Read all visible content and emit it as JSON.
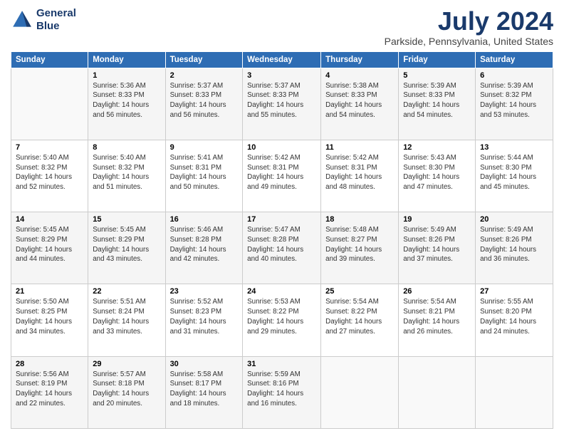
{
  "logo": {
    "line1": "General",
    "line2": "Blue"
  },
  "header": {
    "title": "July 2024",
    "subtitle": "Parkside, Pennsylvania, United States"
  },
  "columns": [
    "Sunday",
    "Monday",
    "Tuesday",
    "Wednesday",
    "Thursday",
    "Friday",
    "Saturday"
  ],
  "weeks": [
    [
      {
        "day": "",
        "sunrise": "",
        "sunset": "",
        "daylight": ""
      },
      {
        "day": "1",
        "sunrise": "Sunrise: 5:36 AM",
        "sunset": "Sunset: 8:33 PM",
        "daylight": "Daylight: 14 hours and 56 minutes."
      },
      {
        "day": "2",
        "sunrise": "Sunrise: 5:37 AM",
        "sunset": "Sunset: 8:33 PM",
        "daylight": "Daylight: 14 hours and 56 minutes."
      },
      {
        "day": "3",
        "sunrise": "Sunrise: 5:37 AM",
        "sunset": "Sunset: 8:33 PM",
        "daylight": "Daylight: 14 hours and 55 minutes."
      },
      {
        "day": "4",
        "sunrise": "Sunrise: 5:38 AM",
        "sunset": "Sunset: 8:33 PM",
        "daylight": "Daylight: 14 hours and 54 minutes."
      },
      {
        "day": "5",
        "sunrise": "Sunrise: 5:39 AM",
        "sunset": "Sunset: 8:33 PM",
        "daylight": "Daylight: 14 hours and 54 minutes."
      },
      {
        "day": "6",
        "sunrise": "Sunrise: 5:39 AM",
        "sunset": "Sunset: 8:32 PM",
        "daylight": "Daylight: 14 hours and 53 minutes."
      }
    ],
    [
      {
        "day": "7",
        "sunrise": "Sunrise: 5:40 AM",
        "sunset": "Sunset: 8:32 PM",
        "daylight": "Daylight: 14 hours and 52 minutes."
      },
      {
        "day": "8",
        "sunrise": "Sunrise: 5:40 AM",
        "sunset": "Sunset: 8:32 PM",
        "daylight": "Daylight: 14 hours and 51 minutes."
      },
      {
        "day": "9",
        "sunrise": "Sunrise: 5:41 AM",
        "sunset": "Sunset: 8:31 PM",
        "daylight": "Daylight: 14 hours and 50 minutes."
      },
      {
        "day": "10",
        "sunrise": "Sunrise: 5:42 AM",
        "sunset": "Sunset: 8:31 PM",
        "daylight": "Daylight: 14 hours and 49 minutes."
      },
      {
        "day": "11",
        "sunrise": "Sunrise: 5:42 AM",
        "sunset": "Sunset: 8:31 PM",
        "daylight": "Daylight: 14 hours and 48 minutes."
      },
      {
        "day": "12",
        "sunrise": "Sunrise: 5:43 AM",
        "sunset": "Sunset: 8:30 PM",
        "daylight": "Daylight: 14 hours and 47 minutes."
      },
      {
        "day": "13",
        "sunrise": "Sunrise: 5:44 AM",
        "sunset": "Sunset: 8:30 PM",
        "daylight": "Daylight: 14 hours and 45 minutes."
      }
    ],
    [
      {
        "day": "14",
        "sunrise": "Sunrise: 5:45 AM",
        "sunset": "Sunset: 8:29 PM",
        "daylight": "Daylight: 14 hours and 44 minutes."
      },
      {
        "day": "15",
        "sunrise": "Sunrise: 5:45 AM",
        "sunset": "Sunset: 8:29 PM",
        "daylight": "Daylight: 14 hours and 43 minutes."
      },
      {
        "day": "16",
        "sunrise": "Sunrise: 5:46 AM",
        "sunset": "Sunset: 8:28 PM",
        "daylight": "Daylight: 14 hours and 42 minutes."
      },
      {
        "day": "17",
        "sunrise": "Sunrise: 5:47 AM",
        "sunset": "Sunset: 8:28 PM",
        "daylight": "Daylight: 14 hours and 40 minutes."
      },
      {
        "day": "18",
        "sunrise": "Sunrise: 5:48 AM",
        "sunset": "Sunset: 8:27 PM",
        "daylight": "Daylight: 14 hours and 39 minutes."
      },
      {
        "day": "19",
        "sunrise": "Sunrise: 5:49 AM",
        "sunset": "Sunset: 8:26 PM",
        "daylight": "Daylight: 14 hours and 37 minutes."
      },
      {
        "day": "20",
        "sunrise": "Sunrise: 5:49 AM",
        "sunset": "Sunset: 8:26 PM",
        "daylight": "Daylight: 14 hours and 36 minutes."
      }
    ],
    [
      {
        "day": "21",
        "sunrise": "Sunrise: 5:50 AM",
        "sunset": "Sunset: 8:25 PM",
        "daylight": "Daylight: 14 hours and 34 minutes."
      },
      {
        "day": "22",
        "sunrise": "Sunrise: 5:51 AM",
        "sunset": "Sunset: 8:24 PM",
        "daylight": "Daylight: 14 hours and 33 minutes."
      },
      {
        "day": "23",
        "sunrise": "Sunrise: 5:52 AM",
        "sunset": "Sunset: 8:23 PM",
        "daylight": "Daylight: 14 hours and 31 minutes."
      },
      {
        "day": "24",
        "sunrise": "Sunrise: 5:53 AM",
        "sunset": "Sunset: 8:22 PM",
        "daylight": "Daylight: 14 hours and 29 minutes."
      },
      {
        "day": "25",
        "sunrise": "Sunrise: 5:54 AM",
        "sunset": "Sunset: 8:22 PM",
        "daylight": "Daylight: 14 hours and 27 minutes."
      },
      {
        "day": "26",
        "sunrise": "Sunrise: 5:54 AM",
        "sunset": "Sunset: 8:21 PM",
        "daylight": "Daylight: 14 hours and 26 minutes."
      },
      {
        "day": "27",
        "sunrise": "Sunrise: 5:55 AM",
        "sunset": "Sunset: 8:20 PM",
        "daylight": "Daylight: 14 hours and 24 minutes."
      }
    ],
    [
      {
        "day": "28",
        "sunrise": "Sunrise: 5:56 AM",
        "sunset": "Sunset: 8:19 PM",
        "daylight": "Daylight: 14 hours and 22 minutes."
      },
      {
        "day": "29",
        "sunrise": "Sunrise: 5:57 AM",
        "sunset": "Sunset: 8:18 PM",
        "daylight": "Daylight: 14 hours and 20 minutes."
      },
      {
        "day": "30",
        "sunrise": "Sunrise: 5:58 AM",
        "sunset": "Sunset: 8:17 PM",
        "daylight": "Daylight: 14 hours and 18 minutes."
      },
      {
        "day": "31",
        "sunrise": "Sunrise: 5:59 AM",
        "sunset": "Sunset: 8:16 PM",
        "daylight": "Daylight: 14 hours and 16 minutes."
      },
      {
        "day": "",
        "sunrise": "",
        "sunset": "",
        "daylight": ""
      },
      {
        "day": "",
        "sunrise": "",
        "sunset": "",
        "daylight": ""
      },
      {
        "day": "",
        "sunrise": "",
        "sunset": "",
        "daylight": ""
      }
    ]
  ]
}
